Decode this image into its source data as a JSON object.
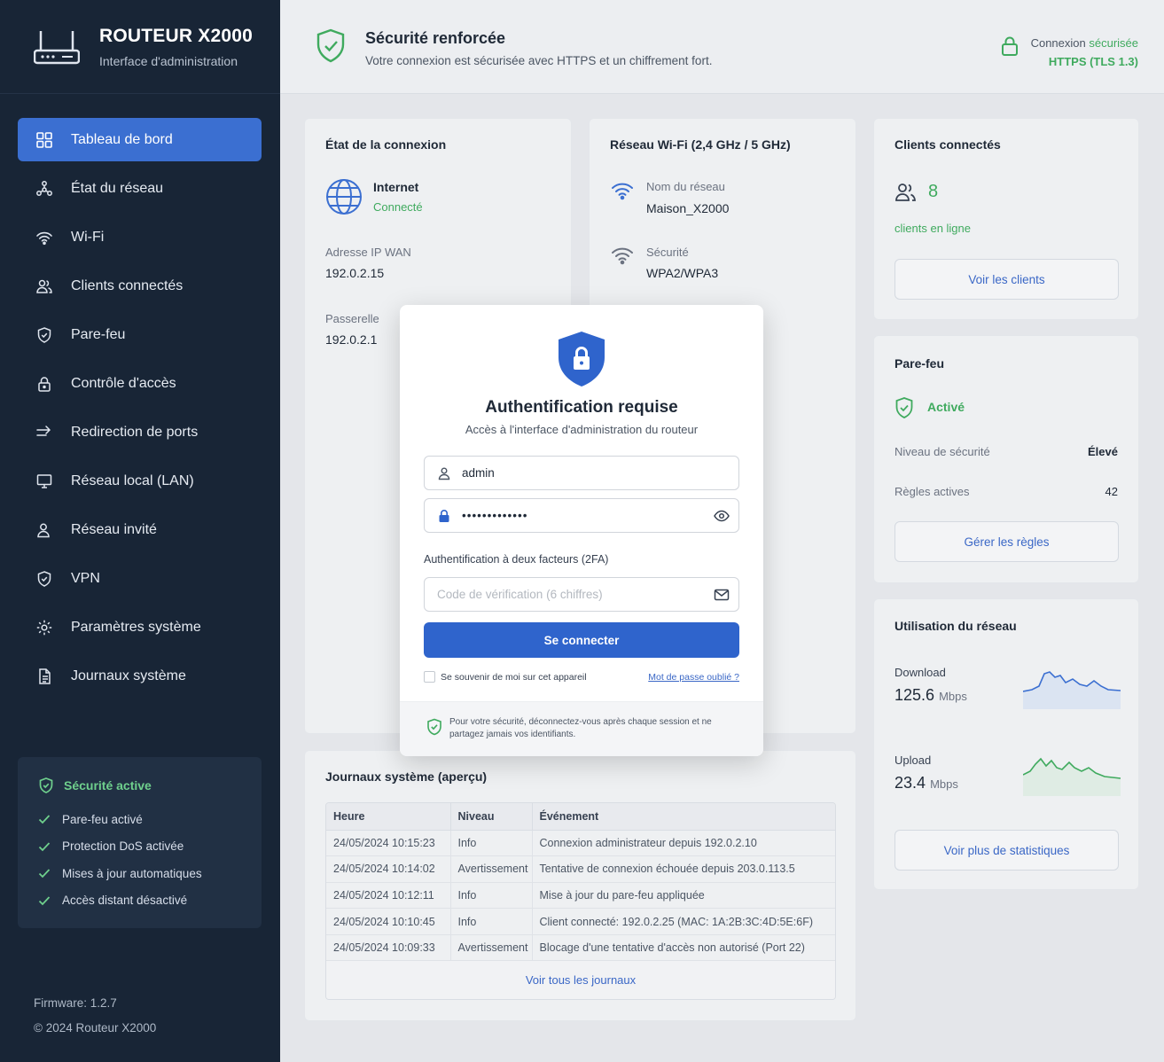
{
  "sidebar": {
    "brand_title": "ROUTEUR X2000",
    "brand_subtitle": "Interface d'administration",
    "items": [
      {
        "label": "Tableau de bord",
        "icon": "dashboard-icon",
        "active": true
      },
      {
        "label": "État du réseau",
        "icon": "network-icon"
      },
      {
        "label": "Wi-Fi",
        "icon": "wifi-icon"
      },
      {
        "label": "Clients connectés",
        "icon": "users-icon"
      },
      {
        "label": "Pare-feu",
        "icon": "shield-icon"
      },
      {
        "label": "Contrôle d'accès",
        "icon": "lock-icon"
      },
      {
        "label": "Redirection de ports",
        "icon": "arrow-right-icon"
      },
      {
        "label": "Réseau local (LAN)",
        "icon": "monitor-icon"
      },
      {
        "label": "Réseau invité",
        "icon": "guest-user-icon"
      },
      {
        "label": "VPN",
        "icon": "vpn-shield-icon"
      },
      {
        "label": "Paramètres système",
        "icon": "gear-icon"
      },
      {
        "label": "Journaux système",
        "icon": "document-icon"
      }
    ],
    "security": {
      "title": "Sécurité active",
      "items": [
        "Pare-feu activé",
        "Protection DoS activée",
        "Mises à jour automatiques",
        "Accès distant désactivé"
      ]
    },
    "firmware": "Firmware: 1.2.7",
    "copyright": "© 2024 Routeur X2000"
  },
  "topbar": {
    "title": "Sécurité renforcée",
    "subtitle": "Votre connexion est sécurisée avec HTTPS et un chiffrement fort.",
    "conn_prefix": "Connexion",
    "conn_status": "sécurisée",
    "conn_protocol": "HTTPS (TLS 1.3)"
  },
  "connection": {
    "title": "État de la connexion",
    "internet_label": "Internet",
    "internet_status": "Connecté",
    "wan_label": "Adresse IP WAN",
    "wan_value": "192.0.2.15",
    "gateway_label": "Passerelle",
    "gateway_value": "192.0.2.1"
  },
  "wifi": {
    "title": "Réseau Wi-Fi (2,4 GHz / 5 GHz)",
    "ssid_label": "Nom du réseau",
    "ssid_value": "Maison_X2000",
    "security_label": "Sécurité",
    "security_value": "WPA2/WPA3"
  },
  "clients": {
    "title": "Clients connectés",
    "count": "8",
    "caption": "clients en ligne",
    "button": "Voir les clients"
  },
  "firewall": {
    "title": "Pare-feu",
    "status": "Activé",
    "level_label": "Niveau de sécurité",
    "level_value": "Élevé",
    "rules_label": "Règles actives",
    "rules_value": "42",
    "button": "Gérer les règles"
  },
  "usage": {
    "title": "Utilisation du réseau",
    "download_label": "Download",
    "download_value": "125.6",
    "download_unit": "Mbps",
    "upload_label": "Upload",
    "upload_value": "23.4",
    "upload_unit": "Mbps",
    "button": "Voir plus de statistiques"
  },
  "logs": {
    "title": "Journaux système (aperçu)",
    "headers": [
      "Heure",
      "Niveau",
      "Événement"
    ],
    "rows": [
      [
        "24/05/2024 10:15:23",
        "Info",
        "Connexion administrateur depuis 192.0.2.10"
      ],
      [
        "24/05/2024 10:14:02",
        "Avertissement",
        "Tentative de connexion échouée depuis 203.0.113.5"
      ],
      [
        "24/05/2024 10:12:11",
        "Info",
        "Mise à jour du pare-feu appliquée"
      ],
      [
        "24/05/2024 10:10:45",
        "Info",
        "Client connecté: 192.0.2.25 (MAC: 1A:2B:3C:4D:5E:6F)"
      ],
      [
        "24/05/2024 10:09:33",
        "Avertissement",
        "Blocage d'une tentative d'accès non autorisé (Port 22)"
      ]
    ],
    "link": "Voir tous les journaux"
  },
  "modal": {
    "title": "Authentification requise",
    "subtitle": "Accès à l'interface d'administration du routeur",
    "username": "admin",
    "password": "•••••••••••••",
    "twofa_label": "Authentification à deux facteurs (2FA)",
    "code_placeholder": "Code de vérification (6 chiffres)",
    "submit": "Se connecter",
    "remember": "Se souvenir de moi sur cet appareil",
    "forgot": "Mot de passe oublié ?",
    "footer": "Pour votre sécurité, déconnectez-vous après chaque session et ne partagez jamais vos identifiants."
  },
  "colors": {
    "sidebar_bg": "#182536",
    "accent": "#3b6fd1",
    "success": "#3faa5e",
    "warning": "#e59a2e"
  }
}
